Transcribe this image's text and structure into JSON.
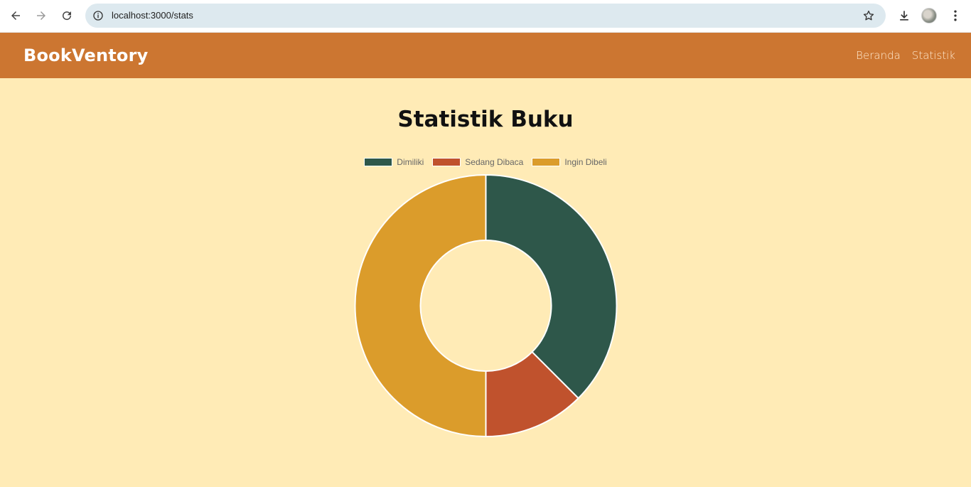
{
  "browser": {
    "url": "localhost:3000/stats"
  },
  "app": {
    "brand": "BookVentory",
    "nav": [
      {
        "label": "Beranda"
      },
      {
        "label": "Statistik"
      }
    ]
  },
  "page": {
    "title": "Statistik Buku"
  },
  "colors": {
    "navbar": "#cc7631",
    "background": "#ffebb6"
  },
  "chart_data": {
    "type": "pie",
    "style": "doughnut",
    "title": "",
    "legend_position": "top",
    "labels": [
      "Dimiliki",
      "Sedang Dibaca",
      "Ingin Dibeli"
    ],
    "values": [
      3,
      1,
      4
    ],
    "colors": [
      "#2e574a",
      "#c0522d",
      "#db9c2b"
    ]
  }
}
